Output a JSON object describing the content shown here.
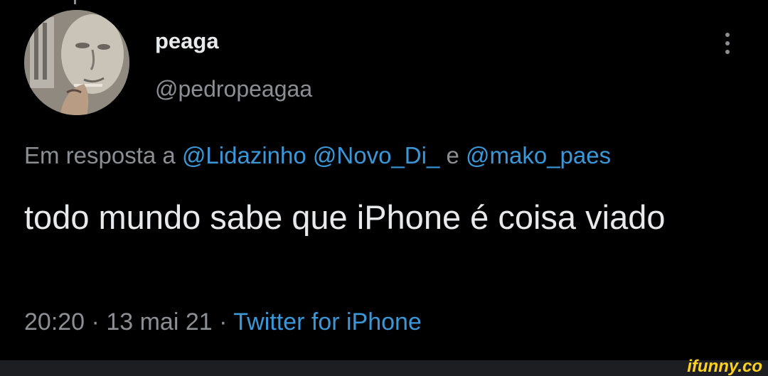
{
  "tweet": {
    "display_name": "peaga",
    "handle": "@pedropeagaa",
    "reply_prefix": "Em resposta a",
    "mentions": [
      "@Lidazinho",
      "@Novo_Di_",
      "@mako_paes"
    ],
    "mention_joiner": "e",
    "text": "todo mundo sabe que iPhone é coisa viado",
    "time": "20:20",
    "date": "13 mai 21",
    "separator": "·",
    "source": "Twitter for iPhone"
  },
  "watermark": "ifunny.co",
  "icons": {
    "more": "more-vertical-icon",
    "avatar": "avatar-image"
  },
  "colors": {
    "background": "#000000",
    "text_primary": "#e7e9ea",
    "text_secondary": "#8b8f94",
    "link": "#3a98d8",
    "watermark": "#ffd21f"
  }
}
